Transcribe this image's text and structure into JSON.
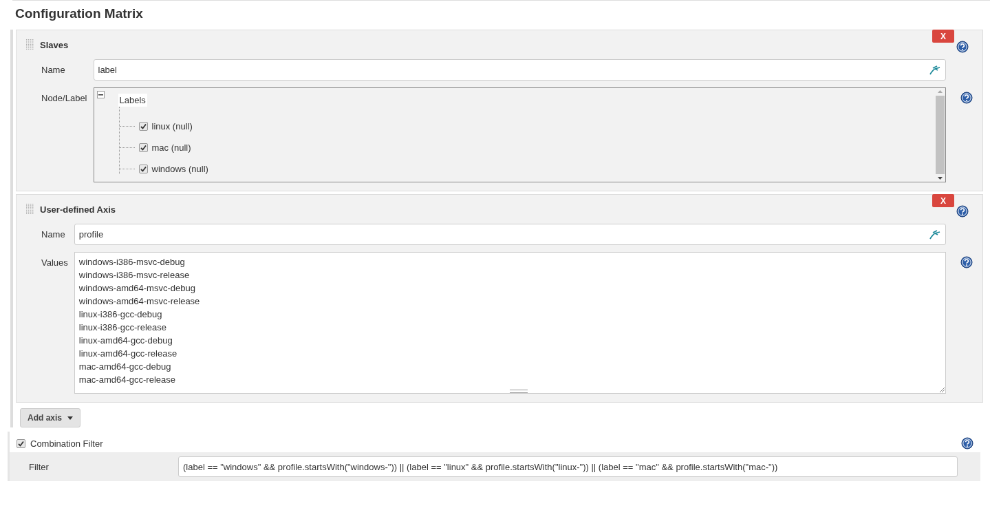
{
  "title": "Configuration Matrix",
  "axes": [
    {
      "kind": "tree",
      "heading": "Slaves",
      "remove": "X",
      "name_label": "Name",
      "name_value": "label",
      "field_label": "Node/Label",
      "tree": {
        "label": "Labels",
        "expanded": true,
        "children": [
          {
            "label": "linux (null)",
            "checked": true
          },
          {
            "label": "mac (null)",
            "checked": true
          },
          {
            "label": "windows (null)",
            "checked": true
          }
        ]
      }
    },
    {
      "kind": "text",
      "heading": "User-defined Axis",
      "remove": "X",
      "name_label": "Name",
      "name_value": "profile",
      "field_label": "Values",
      "values": [
        "windows-i386-msvc-debug",
        "windows-i386-msvc-release",
        "windows-amd64-msvc-debug",
        "windows-amd64-msvc-release",
        "linux-i386-gcc-debug",
        "linux-i386-gcc-release",
        "linux-amd64-gcc-debug",
        "linux-amd64-gcc-release",
        "mac-amd64-gcc-debug",
        "mac-amd64-gcc-release"
      ]
    }
  ],
  "add_axis": "Add axis",
  "combination_filter": {
    "label": "Combination Filter",
    "checked": true,
    "filter_label": "Filter",
    "filter_value": "(label == \"windows\" && profile.startsWith(\"windows-\")) || (label == \"linux\" && profile.startsWith(\"linux-\")) || (label == \"mac\" && profile.startsWith(\"mac-\"))"
  }
}
